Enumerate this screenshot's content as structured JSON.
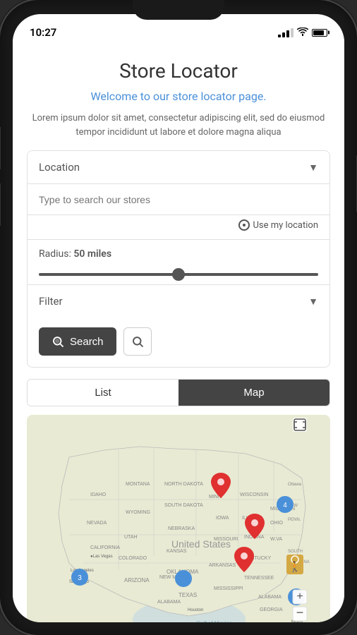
{
  "statusBar": {
    "time": "10:27"
  },
  "header": {
    "title": "Store Locator",
    "welcome": "Welcome to our store locator page.",
    "description": "Lorem ipsum dolor sit amet, consectetur adipiscing elit, sed do eiusmod tempor incididunt ut labore et dolore magna aliqua"
  },
  "searchCard": {
    "locationDropdownLabel": "Location",
    "searchInputPlaceholder": "Type to search our stores",
    "useLocationText": "Use my location",
    "radius": {
      "label": "Radius:",
      "value": "50 miles"
    },
    "filterLabel": "Filter",
    "searchButtonLabel": "Search"
  },
  "viewToggle": {
    "listLabel": "List",
    "mapLabel": "Map"
  },
  "map": {
    "zoomIn": "+",
    "zoomOut": "-",
    "fullscreen": "⛶"
  }
}
